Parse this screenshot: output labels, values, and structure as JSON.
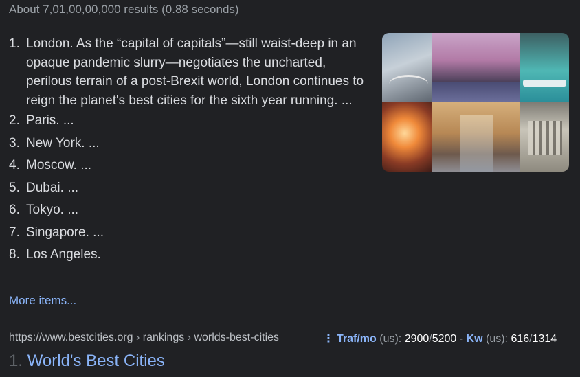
{
  "stats": "About 7,01,00,00,000 results (0.88 seconds)",
  "list": [
    {
      "num": "1.",
      "text": "London. As the “capital of capitals”—still waist-deep in an opaque pandemic slurry—negotiates the uncharted, perilous terrain of a post-Brexit world, London continues to reign the planet's best cities for the sixth year running. ..."
    },
    {
      "num": "2.",
      "text": "Paris. ..."
    },
    {
      "num": "3.",
      "text": "New York. ..."
    },
    {
      "num": "4.",
      "text": "Moscow. ..."
    },
    {
      "num": "5.",
      "text": "Dubai. ..."
    },
    {
      "num": "6.",
      "text": "Tokyo. ..."
    },
    {
      "num": "7.",
      "text": "Singapore. ..."
    },
    {
      "num": "8.",
      "text": "Los Angeles."
    }
  ],
  "more_items": "More items...",
  "result": {
    "url_base": "https://www.bestcities.org",
    "sep1": " › ",
    "crumb1": "rankings",
    "sep2": " › ",
    "crumb2": "worlds-best-cities",
    "index": "1.",
    "title": "World's Best Cities"
  },
  "seo": {
    "dots": "⋮",
    "traf_label": "Traf/mo",
    "traf_region": " (us): ",
    "traf_val1": "2900",
    "traf_slash": "/",
    "traf_val2": "5200",
    "dash": " - ",
    "kw_label": "Kw",
    "kw_region": " (us): ",
    "kw_val1": "616",
    "kw_slash": "/",
    "kw_val2": "1314"
  },
  "colors": {
    "background": "#202124",
    "link": "#8ab4f8",
    "text": "#dadce0"
  }
}
